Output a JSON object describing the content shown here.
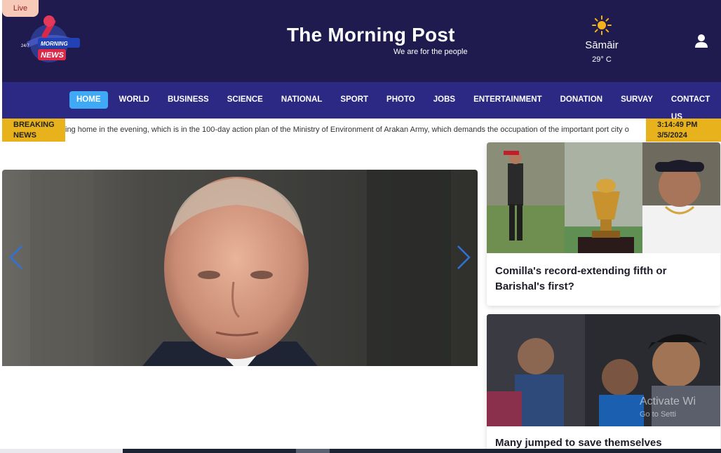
{
  "header": {
    "live_label": "Live",
    "logo_small_text": "24/7",
    "logo_text_1": "MORNING",
    "logo_text_2": "NEWS",
    "title": "The Morning Post",
    "tagline": "We are for the people",
    "weather": {
      "city": "Sāmāir",
      "temp": "29° C",
      "icon": "sun-icon"
    },
    "user_icon": "user-icon",
    "background": "#1f1b4f"
  },
  "nav": {
    "background": "#2b2983",
    "active_color": "#3fa9f5",
    "items": [
      {
        "label": "HOME",
        "active": true
      },
      {
        "label": "WORLD"
      },
      {
        "label": "BUSINESS"
      },
      {
        "label": "SCIENCE"
      },
      {
        "label": "NATIONAL"
      },
      {
        "label": "SPORT"
      },
      {
        "label": "PHOTO"
      },
      {
        "label": "JOBS"
      },
      {
        "label": "ENTERTAINMENT"
      },
      {
        "label": "DONATION"
      },
      {
        "label": "SURVAY"
      },
      {
        "label": "CONTACT US"
      }
    ]
  },
  "ticker": {
    "label_line1": "BREAKING",
    "label_line2": "NEWS",
    "text": "ing home in the evening, which is in the 100-day action plan of the Ministry of Environment of Arakan Army, which demands the occupation of the important port city o",
    "time": "3:14:49 PM",
    "date": "3/5/2024",
    "accent": "#e8b21c"
  },
  "slider": {
    "prev_icon": "chevron-left-icon",
    "next_icon": "chevron-right-icon"
  },
  "cards": [
    {
      "title": "Comilla's record-extending fifth or Barishal's first?"
    },
    {
      "title": "Many jumped to save themselves"
    }
  ],
  "watermark": {
    "line1": "Activate Wi",
    "line2": "Go to Setti"
  }
}
